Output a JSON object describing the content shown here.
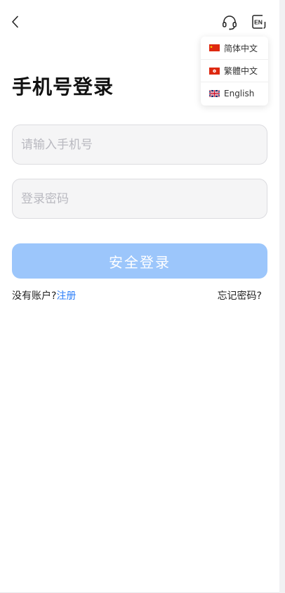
{
  "header": {
    "back_icon": "chevron-left-icon",
    "support_icon": "headset-icon",
    "language_button_label": "EN"
  },
  "language_menu": {
    "items": [
      {
        "label": "简体中文",
        "flag": "china-flag-icon"
      },
      {
        "label": "繁體中文",
        "flag": "hong-kong-flag-icon"
      },
      {
        "label": "English",
        "flag": "uk-flag-icon"
      }
    ]
  },
  "page_title": "手机号登录",
  "form": {
    "phone_placeholder": "请输入手机号",
    "phone_value": "",
    "password_placeholder": "登录密码",
    "password_value": "",
    "submit_label": "安全登录"
  },
  "links": {
    "no_account_text": "没有账户?",
    "register_label": "注册",
    "forgot_password_label": "忘记密码?"
  },
  "colors": {
    "primary_disabled": "#9cc6fb",
    "link": "#2c7ef8",
    "input_background": "#f5f5f6"
  }
}
